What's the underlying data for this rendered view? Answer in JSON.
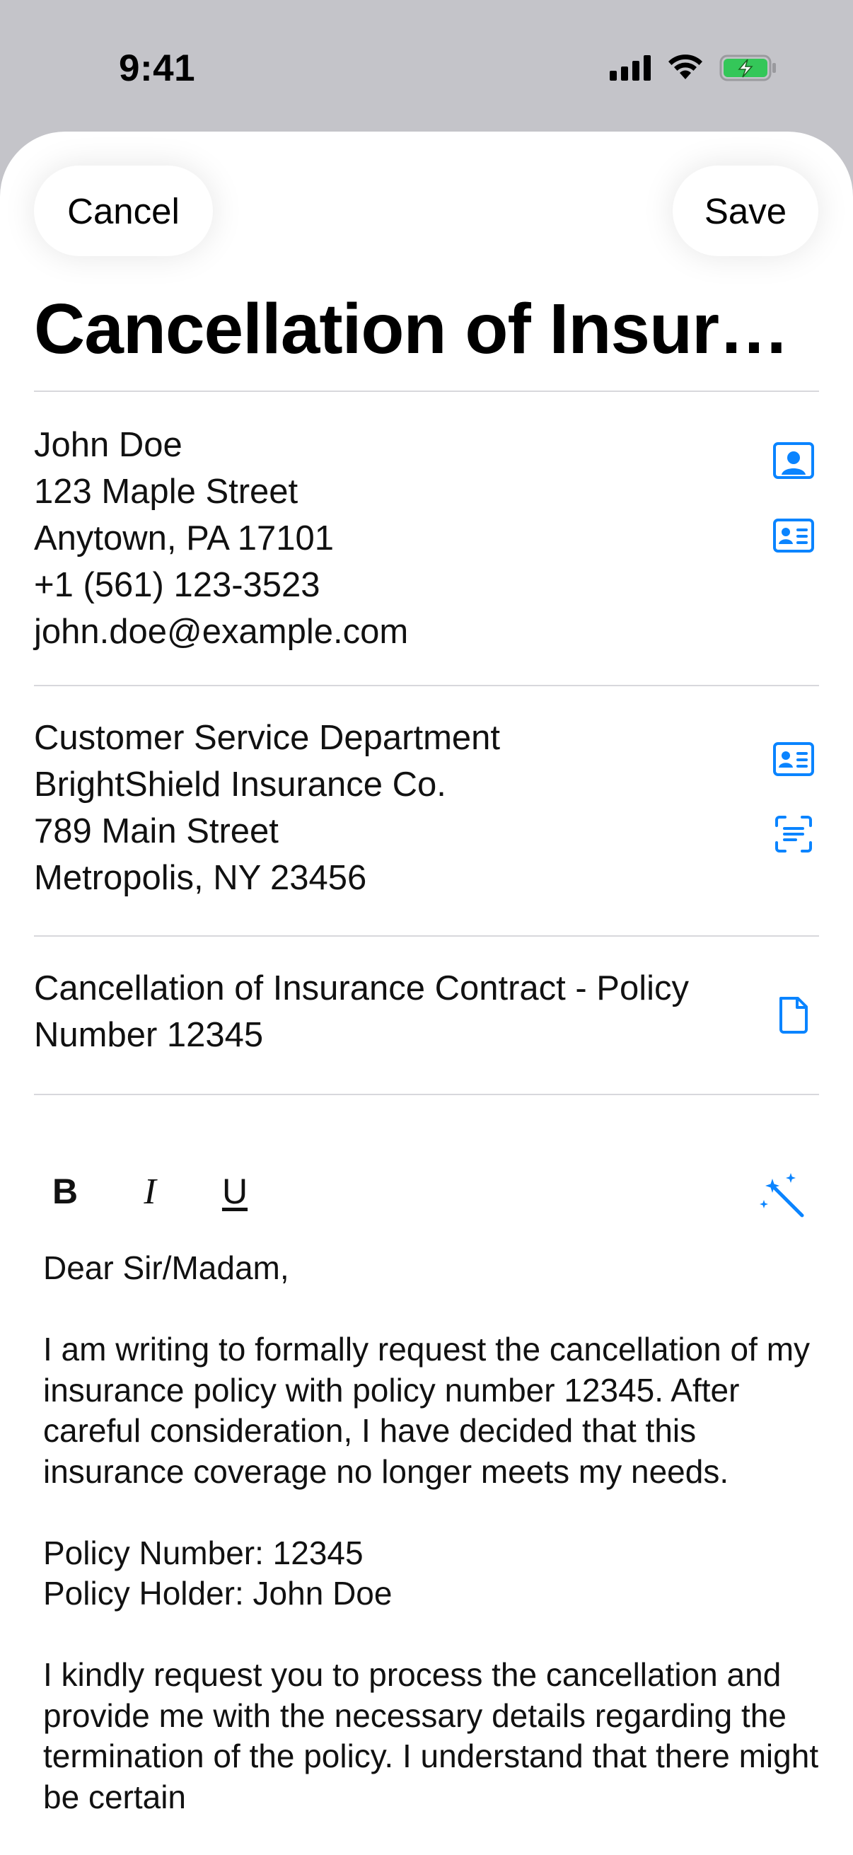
{
  "status_bar": {
    "time": "9:41"
  },
  "nav": {
    "cancel_label": "Cancel",
    "save_label": "Save"
  },
  "title": "Cancellation of Insurance Contract",
  "sender": {
    "lines": [
      "John Doe",
      "123 Maple Street",
      "Anytown, PA 17101",
      "+1 (561) 123-3523",
      "john.doe@example.com"
    ]
  },
  "recipient": {
    "lines": [
      "Customer Service Department",
      "BrightShield Insurance Co.",
      "789 Main Street",
      "Metropolis, NY 23456"
    ]
  },
  "subject": {
    "lines": [
      "Cancellation of Insurance Contract - Policy",
      "Number 12345"
    ]
  },
  "toolbar": {
    "bold": "B",
    "italic": "I",
    "underline": "U"
  },
  "body": {
    "greeting": "Dear Sir/Madam,",
    "para1": "I am writing to formally request the cancellation of my insurance policy with policy number 12345. After careful consideration, I have decided that this insurance coverage no longer meets my needs.",
    "policy_number_line": "Policy Number: 12345",
    "policy_holder_line": "Policy Holder: John Doe",
    "para2": "I kindly request you to process the cancellation and provide me with the necessary details regarding the termination of the policy. I understand that there might be certain"
  },
  "colors": {
    "accent": "#0a84ff",
    "divider": "#d8d8dc",
    "background": "#c4c4c9"
  }
}
